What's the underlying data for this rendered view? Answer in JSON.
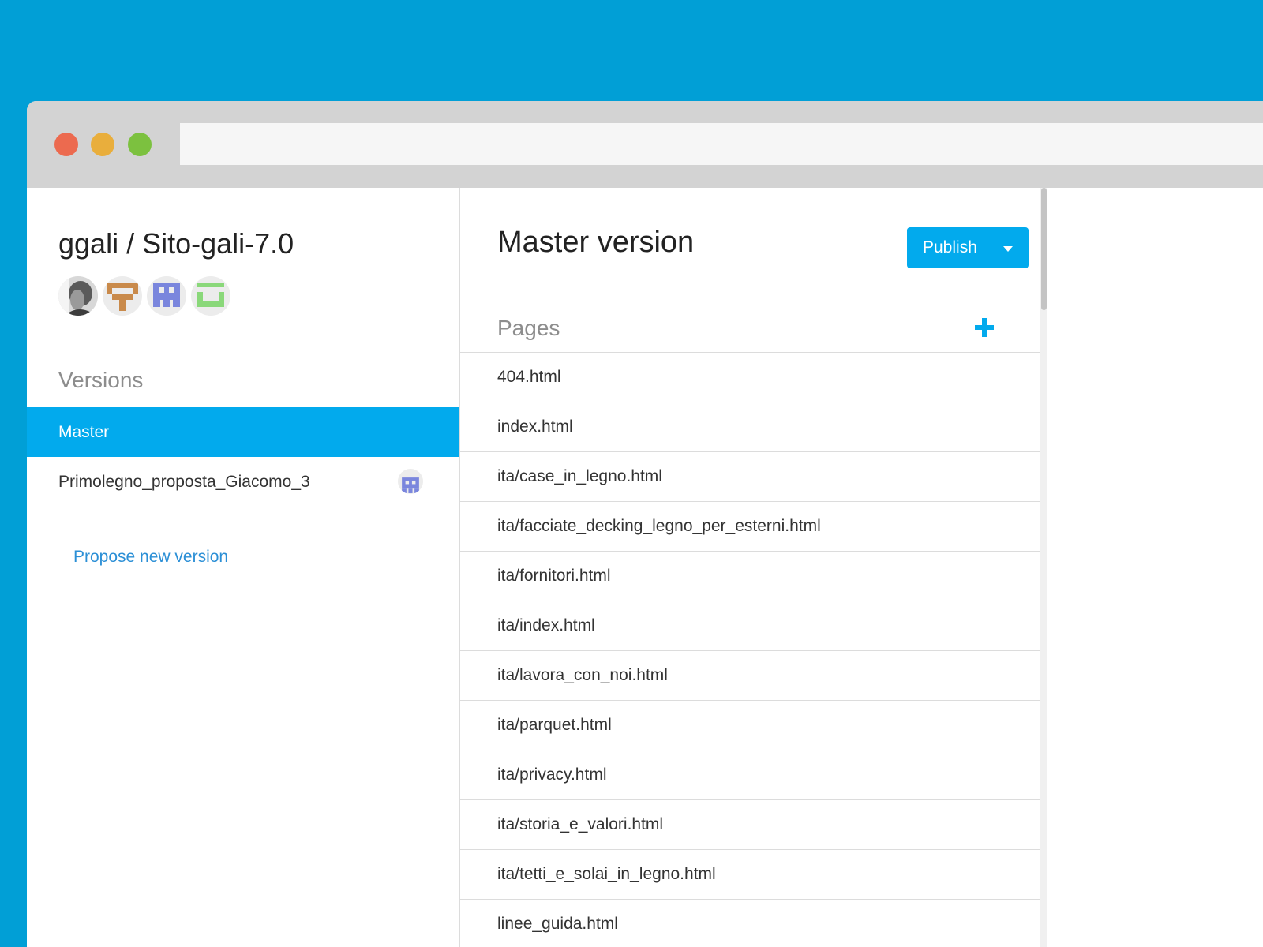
{
  "window": {
    "controls": [
      "close",
      "minimize",
      "zoom"
    ]
  },
  "sidebar": {
    "repo_title": "ggali / Sito-gali-7.0",
    "collaborators": [
      {
        "icon": "photo-avatar-icon"
      },
      {
        "icon": "identicon-avatar-icon",
        "color": "#c98a4b"
      },
      {
        "icon": "identicon-avatar-icon",
        "color": "#7a86dd"
      },
      {
        "icon": "identicon-avatar-icon",
        "color": "#8ad87a"
      }
    ],
    "versions_heading": "Versions",
    "versions": [
      {
        "label": "Master",
        "active": true
      },
      {
        "label": "Primolegno_proposta_Giacomo_3",
        "active": false,
        "author_icon": "identicon-avatar-icon"
      }
    ],
    "propose_link": "Propose new version"
  },
  "main": {
    "title": "Master version",
    "publish_label": "Publish",
    "pages_heading": "Pages",
    "pages": [
      "404.html",
      "index.html",
      "ita/case_in_legno.html",
      "ita/facciate_decking_legno_per_esterni.html",
      "ita/fornitori.html",
      "ita/index.html",
      "ita/lavora_con_noi.html",
      "ita/parquet.html",
      "ita/privacy.html",
      "ita/storia_e_valori.html",
      "ita/tetti_e_solai_in_legno.html",
      "linee_guida.html"
    ]
  },
  "colors": {
    "background": "#019fd6",
    "accent": "#02aaed",
    "link": "#2b8fd6"
  }
}
